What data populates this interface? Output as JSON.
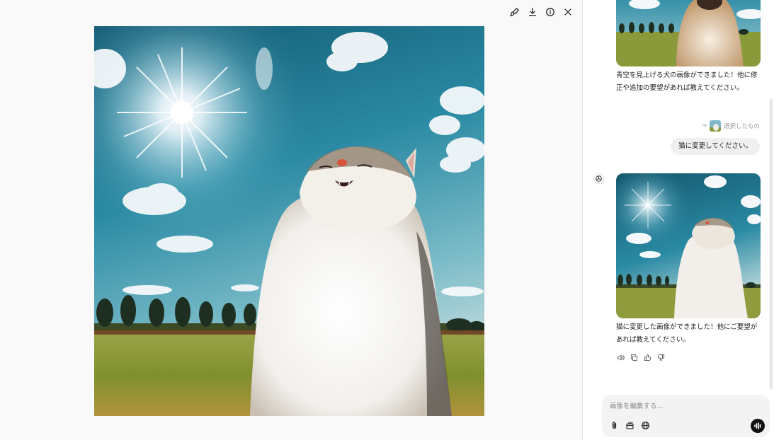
{
  "viewer": {
    "toolbar": {
      "edit_icon": "paint-brush-icon",
      "download_icon": "download-icon",
      "info_icon": "info-icon",
      "close_icon": "close-icon"
    },
    "image_subject": "cat-looking-up-at-sky"
  },
  "chat": {
    "messages": [
      {
        "role": "assistant",
        "text": "青空を見上げる犬の画像ができました！他に修正や追加の要望があれば教えてください。"
      },
      {
        "role": "user",
        "selected_label": "選択したもの",
        "text": "猫に変更してください。"
      },
      {
        "role": "assistant",
        "text": "猫に変更した画像ができました！他にご要望があれば教えてください。"
      }
    ],
    "actions": [
      "speaker-icon",
      "copy-icon",
      "thumbs-up-icon",
      "thumbs-down-icon"
    ],
    "composer": {
      "placeholder": "画像を編集する...",
      "tools": [
        "paperclip-icon",
        "image-gen-icon",
        "globe-icon"
      ],
      "voice_icon": "voice-wave-icon"
    }
  },
  "colors": {
    "sky": "#1f7f99",
    "grass": "#8a9a3a",
    "voice_button": "#111111"
  }
}
